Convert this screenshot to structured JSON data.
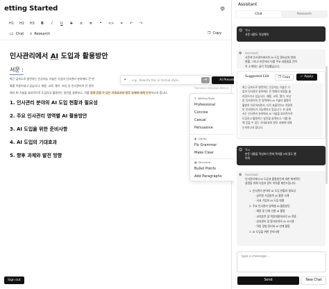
{
  "editor": {
    "doc_title": "etting Started",
    "gear_icon": "gear-icon",
    "toolbar": [
      "H1",
      "H2",
      "H3",
      "B",
      "I",
      "U",
      "S",
      "≡",
      "≣",
      "❝",
      "<>",
      "⌗",
      "↶",
      "↷"
    ],
    "chat_label": "Chat",
    "research_label": "Research",
    "copy_label": "Copy"
  },
  "document": {
    "heading_pre": "인사관리에서 ",
    "heading_ai": "AI",
    "heading_post": " 도입과 활용방안",
    "subtitle": "서문 :",
    "para_line1": "최근 급속도로 발전하는 인공지능 기술은 기업의 인사관리 분야에도 큰 변",
    "para_line2": "화를 이끌어내고 있습니다. 채용, 교육, 평가, 보상 등 인사관리의 전 영역",
    "para_line3": "에서 AI 기술을 효과적으로 도입하고 활용하는 방안을 살펴보고, 이를 ",
    "para_line3_hl": "통해 얻을 수 있는 기대효과와 향후 과제에 대해 논의",
    "para_line3_end": "하고자 합니다.",
    "sections": [
      "1. 인사관리 분야의 AI 도입 현황과 필요성",
      "2. 주요 인사관리 영역별 AI 활용방안",
      "3. AI 도입을 위한 준비사항",
      "4. AI 도입의 기대효과",
      "5. 향후 과제와 발전 방향"
    ],
    "signout_label": "Sign out"
  },
  "ai_popup": {
    "placeholder": "e.g., Rewrite this in formal style...",
    "send_icon": "arrow-right-icon",
    "preset_label": "AI Presets",
    "hint": "Transform Selection With AI",
    "groups": {
      "writing": "Writing Style",
      "clarity": "Clarity",
      "structure": "Structure"
    },
    "items_writing": [
      "Professional",
      "Concise",
      "Casual",
      "Persuasive"
    ],
    "items_clarity": [
      "Fix Grammar",
      "Make Clear"
    ],
    "items_structure": [
      "Bullet Points",
      "Add Paragraphs"
    ]
  },
  "assistant": {
    "title": "Assistant",
    "tabs": [
      "Chat",
      "Research"
    ],
    "active_tab": "Chat",
    "msg1_who": "You",
    "msg1_text": "서문 내용도 작성해줘",
    "msg2_who": "Assistant",
    "msg2_lines": [
      "서문에 인사관리에서의 AI 도입 필요성과 현재",
      "현황, 그리고 본문에서 다룰 주요 내용들을 간략",
      "히 소개하는 글이 작성했습니다."
    ],
    "suggested_label": "Suggested Edit",
    "copy_label": "Copy",
    "apply_label": "Apply",
    "suggested_lines": [
      "최근 급속도로 발전하는 인공지능 기술은 기",
      "업의 인사관리 분야에도 큰 변화의 바람을 불",
      "러일으키고 있습니다. 채용, 교육, 평가, 보상",
      "등 인사관리의 전 영역에서 AI 기술의 활용이",
      "활발히 이루어지면서, 더욱 효율적이고 객관적",
      "인 인사관리가 가능해지고 있습니다. 본 글에",
      "서는 인사관리 분야에서 AI 기술을 효과적으로",
      "도입하고 활용하는 방안을 살펴보고, 이를 통",
      "해 얻을 수 있는 기대효과와 향후 과제에 대해",
      "논의하고자 합니다."
    ],
    "msg3_who": "You",
    "msg3_lines": [
      "본문 내용을 작성하기 전에 목차를 5개 정도 뽑",
      "아줘"
    ],
    "msg4_who": "Assistant",
    "msg4_lines": [
      "인사관리에서 AI 도입과 활용방안에 대한 체계적인",
      "설명을 위해 다음과 같이 목차를 제안드립니다:"
    ],
    "list_lines": [
      "1. 인사관리 분야의 AI 도입 현황과 필요성",
      "  · 글로벌 기업들의 AI 활용 사례",
      "  · 국내 기업의 AI 도입 현황",
      "2. 주요 인사관리 영역별 AI 활용방안",
      "  · 채용 및 인재 선발 AI 활용",
      "  · 교육훈련 및 역량개발에서의 AI 적용",
      "  · 성과관리 및 평가분야의 AI 시스템",
      "  · 직원 경험 관리와 AI 연계 활용",
      "3. AI 도입을 위한 준비사항"
    ],
    "input_placeholder": "Type a message...",
    "send_label": "Send",
    "newchat_label": "New Chat"
  }
}
